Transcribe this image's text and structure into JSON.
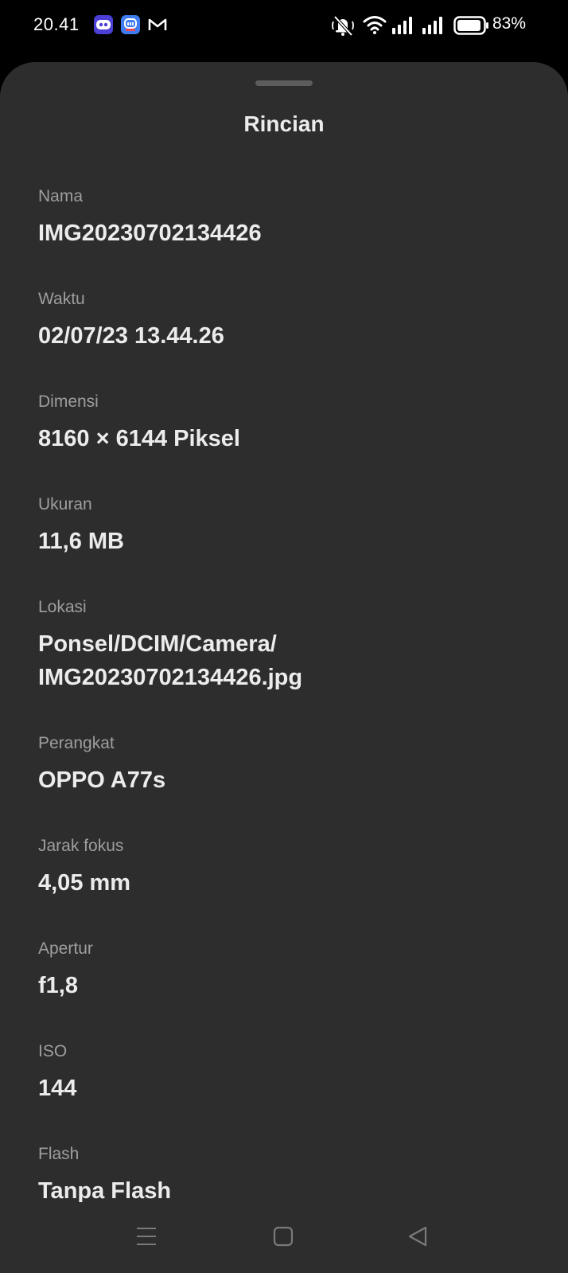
{
  "status_bar": {
    "time": "20.41",
    "battery": "83%",
    "app_icons": [
      "game-app-icon",
      "chat-app-icon",
      "gmail-icon"
    ],
    "system_icons": [
      "mute-bell-icon",
      "wifi-icon",
      "signal-icon",
      "signal-icon",
      "battery-icon"
    ]
  },
  "sheet": {
    "title": "Rincian",
    "fields": [
      {
        "label": "Nama",
        "value": "IMG20230702134426"
      },
      {
        "label": "Waktu",
        "value": "02/07/23 13.44.26"
      },
      {
        "label": "Dimensi",
        "value": "8160 × 6144 Piksel"
      },
      {
        "label": "Ukuran",
        "value": "11,6 MB"
      },
      {
        "label": "Lokasi",
        "value_lines": [
          "Ponsel/DCIM/Camera/",
          "IMG20230702134426.jpg"
        ]
      },
      {
        "label": "Perangkat",
        "value": "OPPO A77s"
      },
      {
        "label": "Jarak fokus",
        "value": "4,05 mm"
      },
      {
        "label": "Apertur",
        "value": "f1,8"
      },
      {
        "label": "ISO",
        "value": "144"
      },
      {
        "label": "Flash",
        "value": "Tanpa Flash"
      }
    ]
  },
  "nav_bar": {
    "buttons": [
      "menu-icon",
      "home-icon",
      "back-icon"
    ]
  },
  "colors": {
    "background": "#000000",
    "sheet": "#2d2d2d",
    "label": "#9e9e9e",
    "value": "#ececec"
  }
}
